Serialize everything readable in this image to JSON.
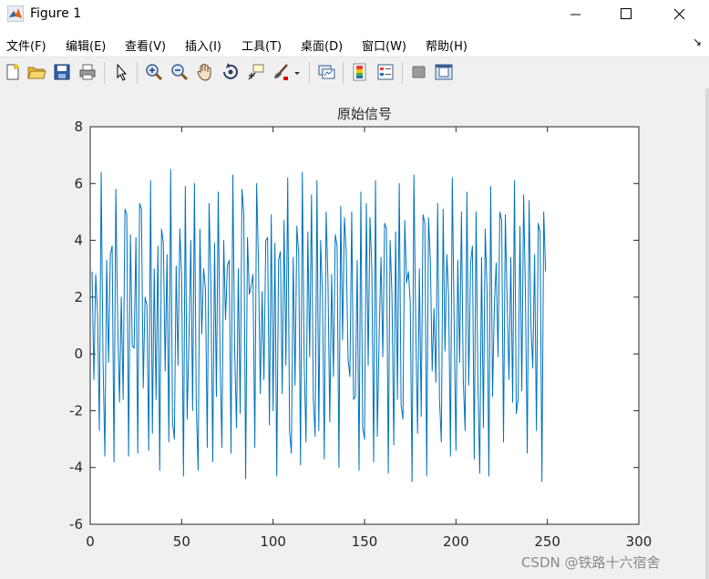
{
  "window": {
    "title": "Figure 1",
    "minimize_symbol": "—",
    "maximize_symbol": "☐",
    "close_symbol": "✕"
  },
  "menu": {
    "items": [
      "文件(F)",
      "编辑(E)",
      "查看(V)",
      "插入(I)",
      "工具(T)",
      "桌面(D)",
      "窗口(W)",
      "帮助(H)"
    ],
    "overflow_arrow": "↘"
  },
  "toolbar": {
    "icons": [
      "new-figure-icon",
      "open-file-icon",
      "save-icon",
      "print-icon",
      "pointer-icon",
      "zoom-in-icon",
      "zoom-out-icon",
      "pan-hand-icon",
      "rotate-3d-icon",
      "data-cursor-icon",
      "brush-icon",
      "link-plot-icon",
      "colorbar-icon",
      "legend-icon",
      "hide-plot-tools-icon",
      "show-plot-tools-icon"
    ]
  },
  "watermark": "CSDN @铁路十六宿舍",
  "chart_data": {
    "type": "line",
    "title": "原始信号",
    "xlabel": "",
    "ylabel": "",
    "xlim": [
      0,
      300
    ],
    "ylim": [
      -6,
      8
    ],
    "xticks": [
      0,
      50,
      100,
      150,
      200,
      250,
      300
    ],
    "yticks": [
      -6,
      -4,
      -2,
      0,
      2,
      4,
      6,
      8
    ],
    "grid": false,
    "legend": "none",
    "series_color": "#0072bd",
    "series": [
      {
        "values": [
          2.9,
          -0.9,
          2.8,
          1.4,
          -2.7,
          6.4,
          -0.2,
          -3.6,
          3.3,
          -0.3,
          3.5,
          3.8,
          -3.8,
          5.8,
          1.2,
          -1.7,
          2.0,
          -1.6,
          5.1,
          4.9,
          -3.6,
          4.2,
          0.3,
          0.2,
          4.1,
          -3.5,
          5.3,
          5.1,
          -1.2,
          2.0,
          1.7,
          -3.4,
          6.1,
          -2.8,
          3.0,
          -1.6,
          3.8,
          -4.1,
          4.4,
          3.9,
          -0.6,
          3.5,
          -3.1,
          6.5,
          -2.4,
          -3.0,
          3.1,
          -0.4,
          4.4,
          2.7,
          -4.3,
          5.9,
          -2.3,
          0.5,
          4.0,
          -2.0,
          6.0,
          -1.8,
          -4.1,
          4.4,
          0.7,
          3.0,
          2.3,
          -3.3,
          5.3,
          2.4,
          -3.8,
          3.9,
          -1.5,
          5.7,
          -0.1,
          -3.3,
          4.0,
          1.2,
          3.1,
          3.3,
          -3.5,
          6.3,
          0.1,
          -2.6,
          3.0,
          -2.1,
          5.8,
          4.9,
          -4.4,
          4.1,
          2.1,
          2.4,
          2.8,
          -3.3,
          6.0,
          3.2,
          -1.4,
          2.2,
          -0.9,
          4.0,
          4.1,
          -2.5,
          4.9,
          -2.0,
          3.9,
          -4.3,
          3.3,
          3.6,
          -1.4,
          4.7,
          -0.4,
          6.2,
          -2.7,
          -3.5,
          3.4,
          -1.1,
          4.5,
          3.5,
          -3.9,
          6.4,
          -0.3,
          -3.1,
          4.3,
          -0.1,
          5.6,
          -1.6,
          -2.9,
          6.1,
          -2.7,
          4.0,
          2.1,
          -3.7,
          5.0,
          2.6,
          -2.4,
          2.8,
          -0.8,
          4.2,
          3.8,
          -4.0,
          5.2,
          0.5,
          4.8,
          3.6,
          -0.2,
          -0.8,
          5.0,
          -1.6,
          -1.5,
          3.3,
          -4.1,
          5.7,
          -2.6,
          -3.0,
          5.3,
          -0.4,
          4.8,
          3.0,
          -3.8,
          6.1,
          -2.9,
          0.6,
          3.4,
          -0.1,
          4.6,
          4.4,
          -4.2,
          4.0,
          2.1,
          -3.2,
          4.3,
          -1.6,
          6.0,
          -1.8,
          -2.3,
          4.7,
          2.5,
          2.9,
          1.8,
          -4.5,
          6.3,
          1.0,
          -2.8,
          3.0,
          -2.2,
          4.9,
          4.6,
          -4.3,
          4.8,
          3.3,
          -0.6,
          1.6,
          -1.0,
          5.3,
          -1.6,
          -3.1,
          5.1,
          0.1,
          3.5,
          2.0,
          -3.6,
          6.2,
          1.1,
          -3.4,
          3.3,
          -0.3,
          5.0,
          -0.9,
          -2.7,
          5.7,
          -1.1,
          3.2,
          3.8,
          -3.7,
          5.0,
          -1.0,
          -4.2,
          3.4,
          -2.6,
          4.4,
          2.2,
          -4.3,
          5.9,
          -1.5,
          1.7,
          3.2,
          -0.1,
          5.0,
          4.7,
          -3.1,
          4.9,
          1.8,
          -0.9,
          3.4,
          -1.7,
          6.1,
          -2.1,
          -1.6,
          4.5,
          -1.3,
          5.6,
          2.0,
          -3.5,
          5.4,
          1.0,
          -0.5,
          3.5,
          -2.7,
          4.6,
          4.3,
          -4.5,
          5.0,
          2.9
        ]
      }
    ]
  }
}
